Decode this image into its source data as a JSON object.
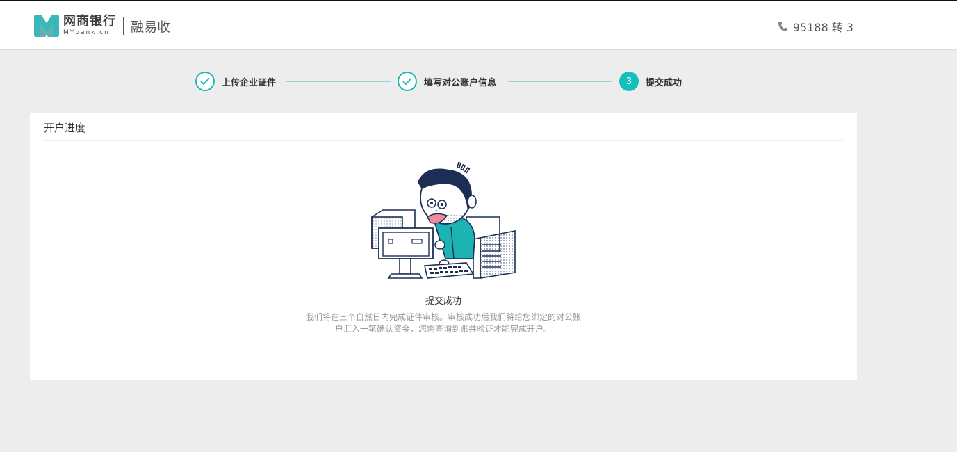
{
  "header": {
    "logo_cn": "网商银行",
    "logo_en": "MYbank.cn",
    "product": "融易收",
    "hotline_icon": "phone-icon",
    "hotline": "95188 转 3"
  },
  "steps": [
    {
      "label": "上传企业证件",
      "status": "done",
      "icon": "check-icon"
    },
    {
      "label": "填写对公账户信息",
      "status": "done",
      "icon": "check-icon"
    },
    {
      "label": "提交成功",
      "status": "active",
      "number": "3"
    }
  ],
  "colors": {
    "accent": "#15bfbe",
    "background": "#ededed",
    "text": "#333333",
    "muted": "#999999"
  },
  "card": {
    "title": "开户进度",
    "illustration": "person-at-computer-illustration",
    "success_title": "提交成功",
    "success_desc": "我们将在三个自然日内完成证件审核。审核成功后我们将给您绑定的对公账户汇入一笔确认资金，您需查询到账并验证才能完成开户。"
  }
}
